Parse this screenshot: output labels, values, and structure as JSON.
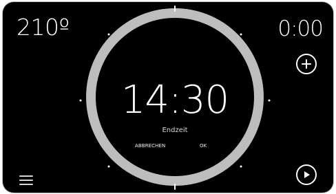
{
  "temperature": "210º",
  "timer": "0:00",
  "dial": {
    "time": "14:30",
    "label": "Endzeit",
    "cancel": "ABBRECHEN",
    "ok": "OK"
  },
  "icons": {
    "menu": "menu-icon",
    "add": "plus-icon",
    "play": "play-icon"
  },
  "colors": {
    "background": "#000000",
    "ring": "#bdbdbd",
    "text": "#ffffff"
  }
}
